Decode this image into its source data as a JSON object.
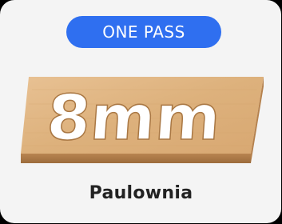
{
  "badge": {
    "label": "ONE PASS",
    "color": "#2f6ff0"
  },
  "product": {
    "engraved_text": "8mm",
    "material": "Paulownia",
    "wood_color": "#e0b684"
  }
}
